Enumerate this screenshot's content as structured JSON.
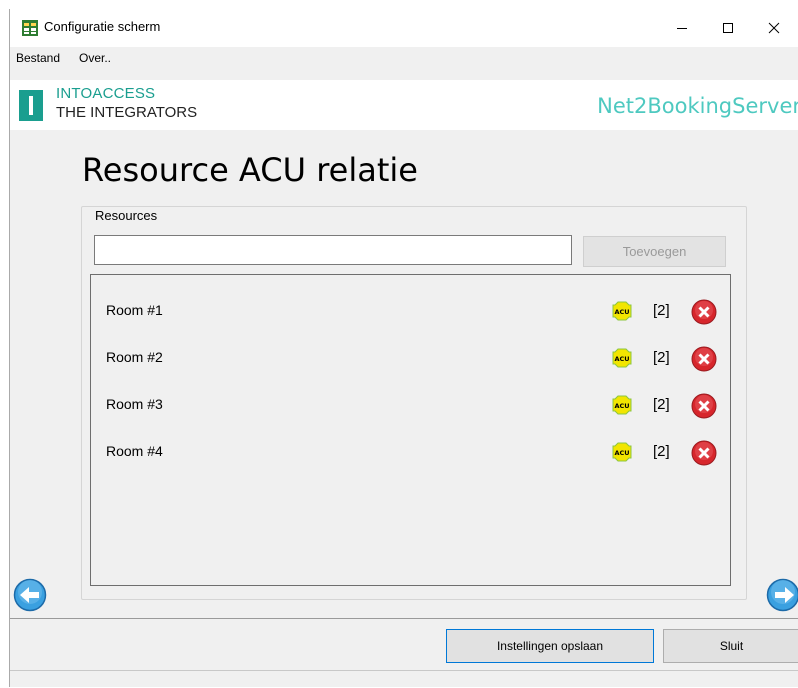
{
  "window": {
    "title": "Configuratie scherm",
    "controls": {
      "minimize": "—",
      "maximize": "☐",
      "close": "✕"
    }
  },
  "menu": {
    "items": [
      {
        "label": "Bestand"
      },
      {
        "label": "Over.."
      }
    ]
  },
  "brand": {
    "logo_line1": "INTOACCESS",
    "logo_line2": "THE INTEGRATORS",
    "app_name": "Net2BookingServer",
    "accent_color": "#1a9e8f",
    "app_name_color": "#4ec9c0"
  },
  "page": {
    "title": "Resource ACU relatie"
  },
  "resources": {
    "group_label": "Resources",
    "input_value": "",
    "input_placeholder": "",
    "add_button_label": "Toevoegen",
    "add_button_enabled": false,
    "rows": [
      {
        "name": "Room #1",
        "acu_icon": "acu-icon",
        "acu_count": "[2]",
        "delete_icon": "delete-icon"
      },
      {
        "name": "Room #2",
        "acu_icon": "acu-icon",
        "acu_count": "[2]",
        "delete_icon": "delete-icon"
      },
      {
        "name": "Room #3",
        "acu_icon": "acu-icon",
        "acu_count": "[2]",
        "delete_icon": "delete-icon"
      },
      {
        "name": "Room #4",
        "acu_icon": "acu-icon",
        "acu_count": "[2]",
        "delete_icon": "delete-icon"
      }
    ]
  },
  "navigation": {
    "back_icon": "arrow-left-circle-icon",
    "forward_icon": "arrow-right-circle-icon"
  },
  "footer": {
    "save_label": "Instellingen opslaan",
    "close_label": "Sluit"
  }
}
